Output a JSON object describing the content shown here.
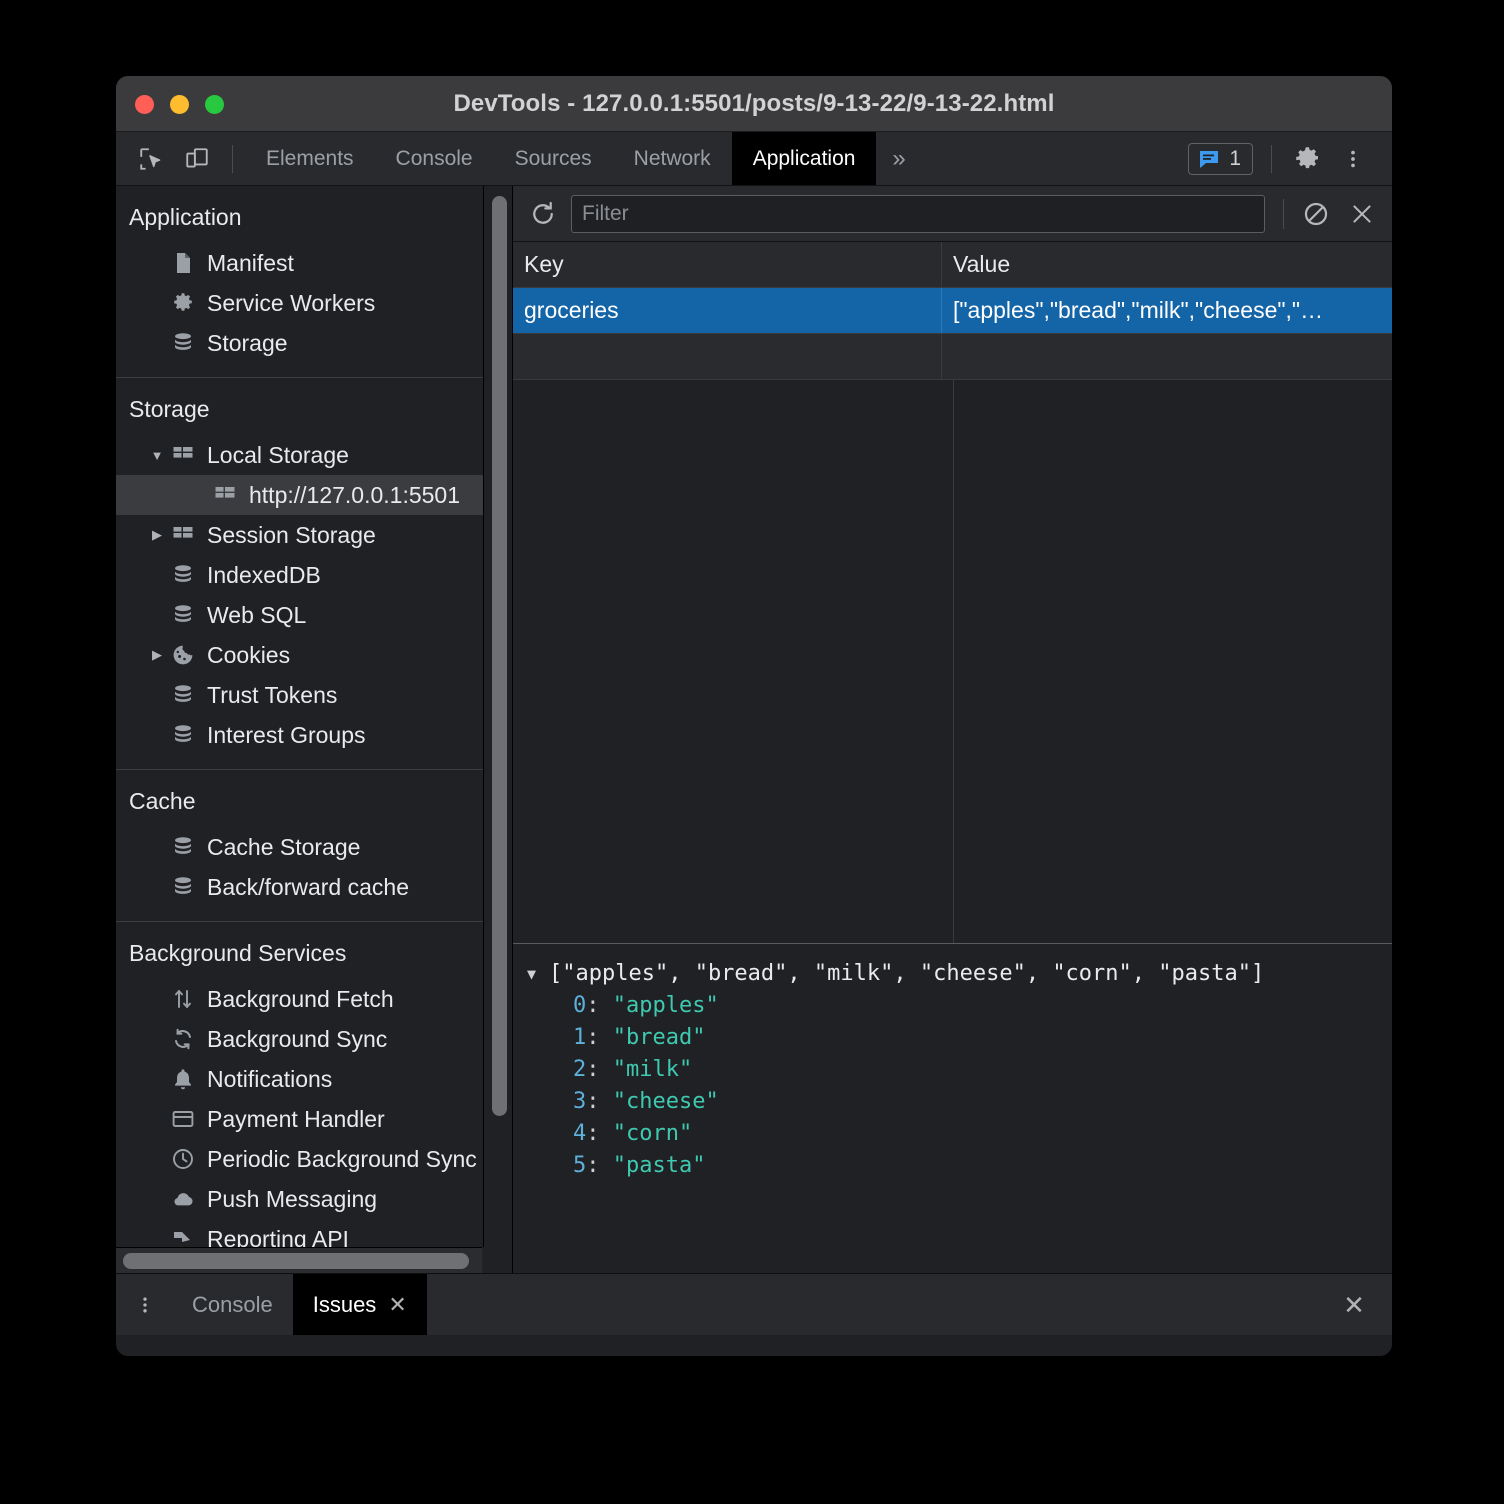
{
  "window": {
    "title": "DevTools - 127.0.0.1:5501/posts/9-13-22/9-13-22.html",
    "traffic_lights": [
      "close",
      "minimize",
      "zoom"
    ],
    "colors": {
      "close": "#ff5f57",
      "minimize": "#febc2e",
      "zoom": "#28c840"
    }
  },
  "tabbar": {
    "left_icons": [
      "inspect-element-icon",
      "device-toolbar-icon"
    ],
    "tabs": [
      {
        "label": "Elements",
        "active": false
      },
      {
        "label": "Console",
        "active": false
      },
      {
        "label": "Sources",
        "active": false
      },
      {
        "label": "Network",
        "active": false
      },
      {
        "label": "Application",
        "active": true
      }
    ],
    "more_label": "»",
    "issues": {
      "icon": "issues-message-icon",
      "count": "1",
      "color": "#3c9bf0"
    },
    "settings_icon": "gear-icon",
    "overflow_icon": "more-vertical-icon"
  },
  "sidebar": {
    "sections": [
      {
        "title": "Application",
        "items": [
          {
            "label": "Manifest",
            "icon": "document-icon",
            "arrow": "",
            "selected": false,
            "indent": 1
          },
          {
            "label": "Service Workers",
            "icon": "gear-icon",
            "arrow": "",
            "selected": false,
            "indent": 1
          },
          {
            "label": "Storage",
            "icon": "database-icon",
            "arrow": "",
            "selected": false,
            "indent": 1
          }
        ]
      },
      {
        "title": "Storage",
        "items": [
          {
            "label": "Local Storage",
            "icon": "table-icon",
            "arrow": "▼",
            "selected": false,
            "indent": 1
          },
          {
            "label": "http://127.0.0.1:5501",
            "icon": "table-icon",
            "arrow": "",
            "selected": true,
            "indent": 2
          },
          {
            "label": "Session Storage",
            "icon": "table-icon",
            "arrow": "▶",
            "selected": false,
            "indent": 1
          },
          {
            "label": "IndexedDB",
            "icon": "database-icon",
            "arrow": "",
            "selected": false,
            "indent": 1
          },
          {
            "label": "Web SQL",
            "icon": "database-icon",
            "arrow": "",
            "selected": false,
            "indent": 1
          },
          {
            "label": "Cookies",
            "icon": "cookie-icon",
            "arrow": "▶",
            "selected": false,
            "indent": 1
          },
          {
            "label": "Trust Tokens",
            "icon": "database-icon",
            "arrow": "",
            "selected": false,
            "indent": 1
          },
          {
            "label": "Interest Groups",
            "icon": "database-icon",
            "arrow": "",
            "selected": false,
            "indent": 1
          }
        ]
      },
      {
        "title": "Cache",
        "items": [
          {
            "label": "Cache Storage",
            "icon": "database-icon",
            "arrow": "",
            "selected": false,
            "indent": 1
          },
          {
            "label": "Back/forward cache",
            "icon": "database-icon",
            "arrow": "",
            "selected": false,
            "indent": 1
          }
        ]
      },
      {
        "title": "Background Services",
        "items": [
          {
            "label": "Background Fetch",
            "icon": "updown-arrows-icon",
            "arrow": "",
            "selected": false,
            "indent": 1
          },
          {
            "label": "Background Sync",
            "icon": "sync-icon",
            "arrow": "",
            "selected": false,
            "indent": 1
          },
          {
            "label": "Notifications",
            "icon": "bell-icon",
            "arrow": "",
            "selected": false,
            "indent": 1
          },
          {
            "label": "Payment Handler",
            "icon": "credit-card-icon",
            "arrow": "",
            "selected": false,
            "indent": 1
          },
          {
            "label": "Periodic Background Sync",
            "icon": "clock-icon",
            "arrow": "",
            "selected": false,
            "indent": 1
          },
          {
            "label": "Push Messaging",
            "icon": "cloud-icon",
            "arrow": "",
            "selected": false,
            "indent": 1
          },
          {
            "label": "Reporting API",
            "icon": "report-icon",
            "arrow": "",
            "selected": false,
            "indent": 1
          }
        ]
      }
    ]
  },
  "storage_toolbar": {
    "refresh_icon": "refresh-icon",
    "filter_placeholder": "Filter",
    "filter_value": "",
    "clear_all_icon": "clear-all-icon",
    "delete_selected_icon": "delete-selected-x-icon"
  },
  "table": {
    "columns": [
      "Key",
      "Value"
    ],
    "rows": [
      {
        "key": "groceries",
        "value": "[\"apples\",\"bread\",\"milk\",\"cheese\",\"…",
        "selected": true
      }
    ]
  },
  "preview": {
    "toggle": "▼",
    "summary": "[\"apples\", \"bread\", \"milk\", \"cheese\", \"corn\", \"pasta\"]",
    "entries": [
      {
        "index": "0",
        "value": "\"apples\""
      },
      {
        "index": "1",
        "value": "\"bread\""
      },
      {
        "index": "2",
        "value": "\"milk\""
      },
      {
        "index": "3",
        "value": "\"cheese\""
      },
      {
        "index": "4",
        "value": "\"corn\""
      },
      {
        "index": "5",
        "value": "\"pasta\""
      }
    ]
  },
  "drawer": {
    "menu_icon": "more-vertical-icon",
    "tabs": [
      {
        "label": "Console",
        "active": false,
        "closable": false
      },
      {
        "label": "Issues",
        "active": true,
        "closable": true
      }
    ],
    "close_icon": "close-icon"
  }
}
